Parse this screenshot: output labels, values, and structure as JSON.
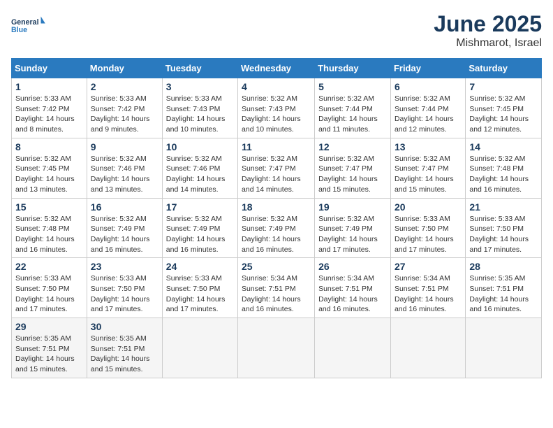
{
  "logo": {
    "general": "General",
    "blue": "Blue"
  },
  "header": {
    "month": "June 2025",
    "location": "Mishmarot, Israel"
  },
  "weekdays": [
    "Sunday",
    "Monday",
    "Tuesday",
    "Wednesday",
    "Thursday",
    "Friday",
    "Saturday"
  ],
  "days": [
    {
      "date": "1",
      "col": 0,
      "sunrise": "5:33 AM",
      "sunset": "7:42 PM",
      "daylight": "14 hours and 8 minutes."
    },
    {
      "date": "2",
      "col": 1,
      "sunrise": "5:33 AM",
      "sunset": "7:42 PM",
      "daylight": "14 hours and 9 minutes."
    },
    {
      "date": "3",
      "col": 2,
      "sunrise": "5:33 AM",
      "sunset": "7:43 PM",
      "daylight": "14 hours and 10 minutes."
    },
    {
      "date": "4",
      "col": 3,
      "sunrise": "5:32 AM",
      "sunset": "7:43 PM",
      "daylight": "14 hours and 10 minutes."
    },
    {
      "date": "5",
      "col": 4,
      "sunrise": "5:32 AM",
      "sunset": "7:44 PM",
      "daylight": "14 hours and 11 minutes."
    },
    {
      "date": "6",
      "col": 5,
      "sunrise": "5:32 AM",
      "sunset": "7:44 PM",
      "daylight": "14 hours and 12 minutes."
    },
    {
      "date": "7",
      "col": 6,
      "sunrise": "5:32 AM",
      "sunset": "7:45 PM",
      "daylight": "14 hours and 12 minutes."
    },
    {
      "date": "8",
      "col": 0,
      "sunrise": "5:32 AM",
      "sunset": "7:45 PM",
      "daylight": "14 hours and 13 minutes."
    },
    {
      "date": "9",
      "col": 1,
      "sunrise": "5:32 AM",
      "sunset": "7:46 PM",
      "daylight": "14 hours and 13 minutes."
    },
    {
      "date": "10",
      "col": 2,
      "sunrise": "5:32 AM",
      "sunset": "7:46 PM",
      "daylight": "14 hours and 14 minutes."
    },
    {
      "date": "11",
      "col": 3,
      "sunrise": "5:32 AM",
      "sunset": "7:47 PM",
      "daylight": "14 hours and 14 minutes."
    },
    {
      "date": "12",
      "col": 4,
      "sunrise": "5:32 AM",
      "sunset": "7:47 PM",
      "daylight": "14 hours and 15 minutes."
    },
    {
      "date": "13",
      "col": 5,
      "sunrise": "5:32 AM",
      "sunset": "7:47 PM",
      "daylight": "14 hours and 15 minutes."
    },
    {
      "date": "14",
      "col": 6,
      "sunrise": "5:32 AM",
      "sunset": "7:48 PM",
      "daylight": "14 hours and 16 minutes."
    },
    {
      "date": "15",
      "col": 0,
      "sunrise": "5:32 AM",
      "sunset": "7:48 PM",
      "daylight": "14 hours and 16 minutes."
    },
    {
      "date": "16",
      "col": 1,
      "sunrise": "5:32 AM",
      "sunset": "7:49 PM",
      "daylight": "14 hours and 16 minutes."
    },
    {
      "date": "17",
      "col": 2,
      "sunrise": "5:32 AM",
      "sunset": "7:49 PM",
      "daylight": "14 hours and 16 minutes."
    },
    {
      "date": "18",
      "col": 3,
      "sunrise": "5:32 AM",
      "sunset": "7:49 PM",
      "daylight": "14 hours and 16 minutes."
    },
    {
      "date": "19",
      "col": 4,
      "sunrise": "5:32 AM",
      "sunset": "7:49 PM",
      "daylight": "14 hours and 17 minutes."
    },
    {
      "date": "20",
      "col": 5,
      "sunrise": "5:33 AM",
      "sunset": "7:50 PM",
      "daylight": "14 hours and 17 minutes."
    },
    {
      "date": "21",
      "col": 6,
      "sunrise": "5:33 AM",
      "sunset": "7:50 PM",
      "daylight": "14 hours and 17 minutes."
    },
    {
      "date": "22",
      "col": 0,
      "sunrise": "5:33 AM",
      "sunset": "7:50 PM",
      "daylight": "14 hours and 17 minutes."
    },
    {
      "date": "23",
      "col": 1,
      "sunrise": "5:33 AM",
      "sunset": "7:50 PM",
      "daylight": "14 hours and 17 minutes."
    },
    {
      "date": "24",
      "col": 2,
      "sunrise": "5:33 AM",
      "sunset": "7:50 PM",
      "daylight": "14 hours and 17 minutes."
    },
    {
      "date": "25",
      "col": 3,
      "sunrise": "5:34 AM",
      "sunset": "7:51 PM",
      "daylight": "14 hours and 16 minutes."
    },
    {
      "date": "26",
      "col": 4,
      "sunrise": "5:34 AM",
      "sunset": "7:51 PM",
      "daylight": "14 hours and 16 minutes."
    },
    {
      "date": "27",
      "col": 5,
      "sunrise": "5:34 AM",
      "sunset": "7:51 PM",
      "daylight": "14 hours and 16 minutes."
    },
    {
      "date": "28",
      "col": 6,
      "sunrise": "5:35 AM",
      "sunset": "7:51 PM",
      "daylight": "14 hours and 16 minutes."
    },
    {
      "date": "29",
      "col": 0,
      "sunrise": "5:35 AM",
      "sunset": "7:51 PM",
      "daylight": "14 hours and 15 minutes."
    },
    {
      "date": "30",
      "col": 1,
      "sunrise": "5:35 AM",
      "sunset": "7:51 PM",
      "daylight": "14 hours and 15 minutes."
    }
  ],
  "labels": {
    "sunrise": "Sunrise:",
    "sunset": "Sunset:",
    "daylight": "Daylight:"
  }
}
